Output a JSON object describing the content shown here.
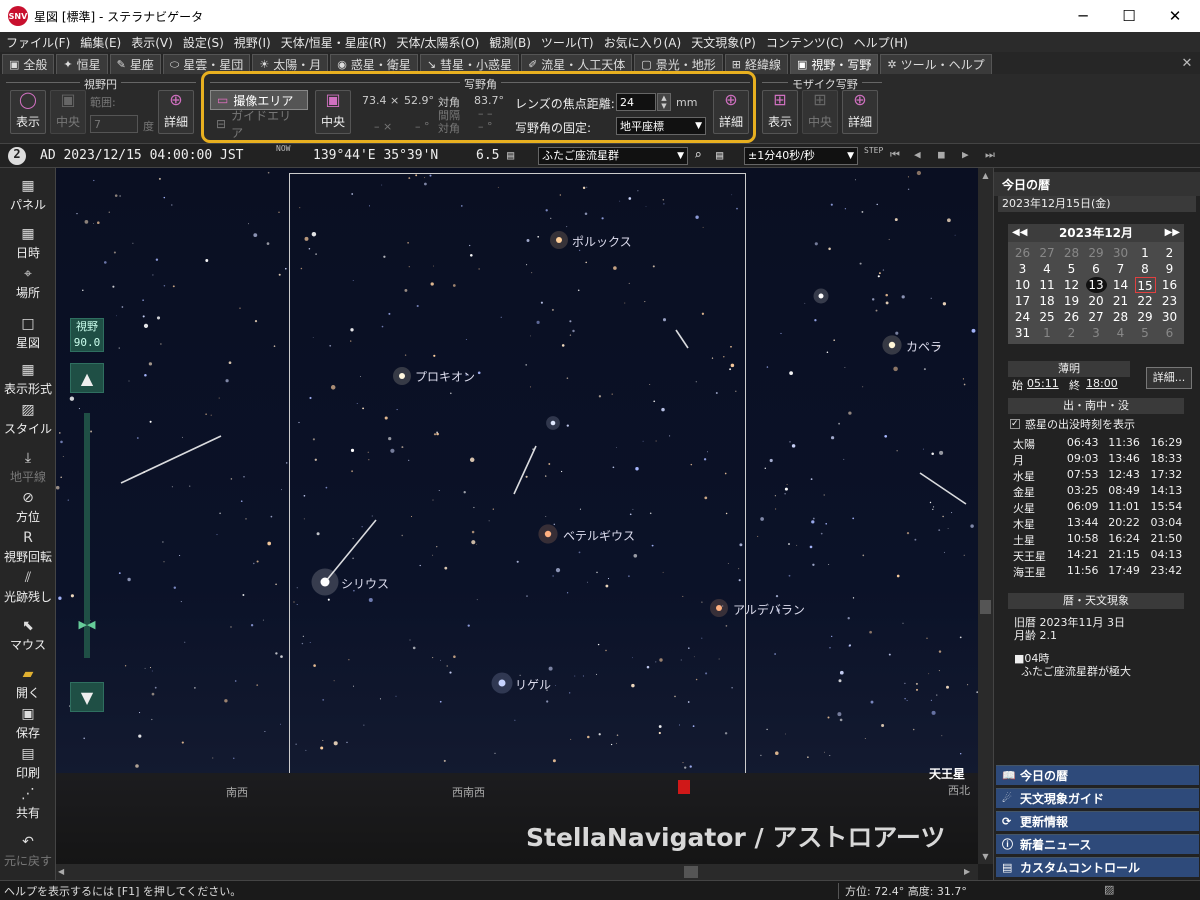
{
  "window": {
    "title": "星図 [標準] - ステラナビゲータ",
    "logo_text": "SNV",
    "minimize": "─",
    "maximize": "☐",
    "close": "✕"
  },
  "menu": [
    "ファイル(F)",
    "編集(E)",
    "表示(V)",
    "設定(S)",
    "視野(I)",
    "天体/恒星・星座(R)",
    "天体/太陽系(O)",
    "観測(B)",
    "ツール(T)",
    "お気に入り(A)",
    "天文現象(P)",
    "コンテンツ(C)",
    "ヘルプ(H)"
  ],
  "tabs": [
    {
      "icon": "▣",
      "label": "全般"
    },
    {
      "icon": "✦",
      "label": "恒星"
    },
    {
      "icon": "✎",
      "label": "星座"
    },
    {
      "icon": "⬭",
      "label": "星雲・星団"
    },
    {
      "icon": "☀",
      "label": "太陽・月"
    },
    {
      "icon": "◉",
      "label": "惑星・衛星"
    },
    {
      "icon": "↘",
      "label": "彗星・小惑星"
    },
    {
      "icon": "✐",
      "label": "流星・人工天体"
    },
    {
      "icon": "▢",
      "label": "景光・地形"
    },
    {
      "icon": "⊞",
      "label": "経緯線"
    },
    {
      "icon": "▣",
      "label": "視野・写野",
      "active": true
    },
    {
      "icon": "✲",
      "label": "ツール・ヘルプ"
    }
  ],
  "ribbon": {
    "fov_circle": {
      "label": "視野円",
      "show": "表示",
      "center": "中央",
      "range_label": "範囲:",
      "range_value": "7",
      "unit": "度",
      "detail": "詳細"
    },
    "camera_fov": {
      "label": "写野角",
      "image_area": "撮像エリア",
      "guide_area": "ガイドエリア",
      "center": "中央",
      "size1": "73.4 ×",
      "size2": "52.9°",
      "diag_label": "対角",
      "diag_value": "83.7°",
      "interval_label": "間隔",
      "interval_value": "– –",
      "diag_label2": "対角",
      "diag_value2": "– °",
      "size3": "– ×",
      "size4": "– °",
      "focal_label": "レンズの焦点距離:",
      "focal_value": "24",
      "focal_unit": "mm",
      "fix_label": "写野角の固定:",
      "fix_value": "地平座標",
      "detail": "詳細"
    },
    "mosaic": {
      "label": "モザイク写野",
      "show": "表示",
      "center": "中央",
      "detail": "詳細"
    }
  },
  "status": {
    "index": "2",
    "datetime": "AD 2023/12/15 04:00:00 JST",
    "now": "NOW",
    "coords": "139°44'E 35°39'N",
    "mag": "6.5",
    "target": "ふたご座流星群",
    "step": "±1分40秒/秒"
  },
  "left_toolbar": [
    {
      "icon": "▦",
      "label": "パネル"
    },
    {
      "icon": "▦",
      "label": "日時"
    },
    {
      "icon": "⌖",
      "label": "場所"
    },
    {
      "icon": "□",
      "label": "星図"
    },
    {
      "icon": "▦",
      "label": "表示形式"
    },
    {
      "icon": "▨",
      "label": "スタイル"
    },
    {
      "icon": "⤓",
      "label": "地平線",
      "disabled": true
    },
    {
      "icon": "⊘",
      "label": "方位"
    },
    {
      "icon": "R",
      "label": "視野回転"
    },
    {
      "icon": "⫽",
      "label": "光跡残し"
    },
    {
      "icon": "⬉",
      "label": "マウス"
    },
    {
      "icon": "▰",
      "label": "開く"
    },
    {
      "icon": "▣",
      "label": "保存"
    },
    {
      "icon": "▤",
      "label": "印刷"
    },
    {
      "icon": "⋰",
      "label": "共有"
    },
    {
      "icon": "↶",
      "label": "元に戻す",
      "disabled": true
    }
  ],
  "sky": {
    "fov_label": "視野",
    "fov_value": "90.0",
    "labels": [
      "ポルックス",
      "カペラ",
      "プロキオン",
      "ベテルギウス",
      "シリウス",
      "アルデバラン",
      "リゲル",
      "天王星"
    ],
    "directions": [
      "南西",
      "西南西",
      "西北"
    ],
    "watermark": "StellaNavigator / アストロアーツ"
  },
  "right_pane": {
    "title": "今日の暦",
    "date": "2023年12月15日(金)",
    "calendar": {
      "month": "2023年12月",
      "days": [
        [
          "26",
          "27",
          "28",
          "29",
          "30",
          "1",
          "2"
        ],
        [
          "3",
          "4",
          "5",
          "6",
          "7",
          "8",
          "9"
        ],
        [
          "10",
          "11",
          "12",
          "13",
          "14",
          "15",
          "16"
        ],
        [
          "17",
          "18",
          "19",
          "20",
          "21",
          "22",
          "23"
        ],
        [
          "24",
          "25",
          "26",
          "27",
          "28",
          "29",
          "30"
        ],
        [
          "31",
          "1",
          "2",
          "3",
          "4",
          "5",
          "6"
        ]
      ]
    },
    "twilight": {
      "label": "薄明",
      "start_label": "始",
      "start": "05:11",
      "end_label": "終",
      "end": "18:00",
      "detail": "詳細..."
    },
    "rise_set": {
      "label": "出・南中・没",
      "checkbox": "惑星の出没時刻を表示",
      "rows": [
        [
          "太陽",
          "06:43",
          "11:36",
          "16:29"
        ],
        [
          "月",
          "09:03",
          "13:46",
          "18:33"
        ],
        [
          "水星",
          "07:53",
          "12:43",
          "17:32"
        ],
        [
          "金星",
          "03:25",
          "08:49",
          "14:13"
        ],
        [
          "火星",
          "06:09",
          "11:01",
          "15:54"
        ],
        [
          "木星",
          "13:44",
          "20:22",
          "03:04"
        ],
        [
          "土星",
          "10:58",
          "16:24",
          "21:50"
        ],
        [
          "天王星",
          "14:21",
          "21:15",
          "04:13"
        ],
        [
          "海王星",
          "11:56",
          "17:49",
          "23:42"
        ]
      ]
    },
    "calendar_events": {
      "label": "暦・天文現象",
      "kyureki": "旧暦 2023年11月 3日",
      "moon_age": "月齢 2.1",
      "event_time": "■04時",
      "event": "ふたご座流星群が極大"
    },
    "buttons": [
      "今日の暦",
      "天文現象ガイド",
      "更新情報",
      "新着ニュース",
      "カスタムコントロール"
    ]
  },
  "bottom_status": {
    "help": "ヘルプを表示するには [F1] を押してください。",
    "azimuth": "方位:  72.4°  高度:  31.7°"
  }
}
